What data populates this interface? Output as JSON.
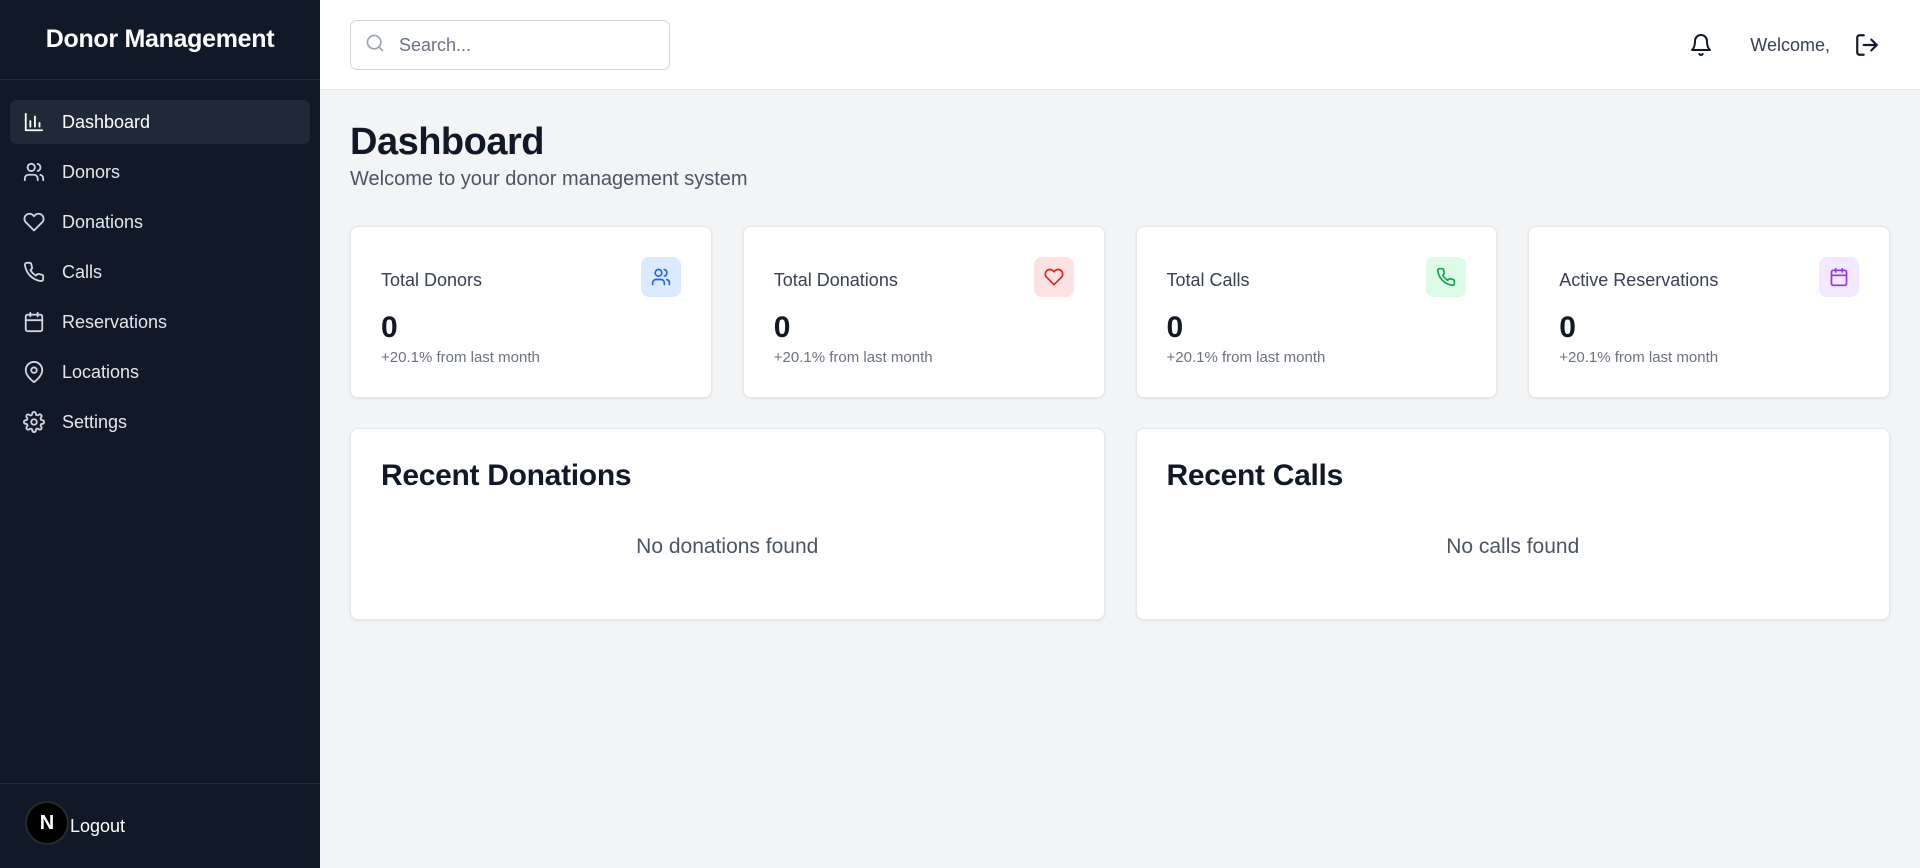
{
  "sidebar": {
    "brand": "Donor Management",
    "items": [
      {
        "label": "Dashboard",
        "icon": "bar-chart-icon"
      },
      {
        "label": "Donors",
        "icon": "users-icon"
      },
      {
        "label": "Donations",
        "icon": "heart-icon"
      },
      {
        "label": "Calls",
        "icon": "phone-icon"
      },
      {
        "label": "Reservations",
        "icon": "calendar-icon"
      },
      {
        "label": "Locations",
        "icon": "map-pin-icon"
      },
      {
        "label": "Settings",
        "icon": "gear-icon"
      }
    ],
    "active": "Dashboard",
    "footer": {
      "badge": "N",
      "label": "Logout"
    }
  },
  "header": {
    "search_placeholder": "Search...",
    "welcome": "Welcome,"
  },
  "page": {
    "title": "Dashboard",
    "subtitle": "Welcome to your donor management system"
  },
  "stats": [
    {
      "label": "Total Donors",
      "value": "0",
      "change": "+20.1% from last month",
      "icon": "users-icon",
      "color": "#2563eb",
      "bg": "#dbeafe"
    },
    {
      "label": "Total Donations",
      "value": "0",
      "change": "+20.1% from last month",
      "icon": "heart-icon",
      "color": "#dc2626",
      "bg": "#fee2e2"
    },
    {
      "label": "Total Calls",
      "value": "0",
      "change": "+20.1% from last month",
      "icon": "phone-icon",
      "color": "#16a34a",
      "bg": "#dcfce7"
    },
    {
      "label": "Active Reservations",
      "value": "0",
      "change": "+20.1% from last month",
      "icon": "calendar-icon",
      "color": "#9333ea",
      "bg": "#f3e8ff"
    }
  ],
  "panels": [
    {
      "title": "Recent Donations",
      "empty": "No donations found"
    },
    {
      "title": "Recent Calls",
      "empty": "No calls found"
    }
  ],
  "colors": {
    "sidebar_bg": "#111827",
    "page_bg": "#f3f4f6"
  }
}
